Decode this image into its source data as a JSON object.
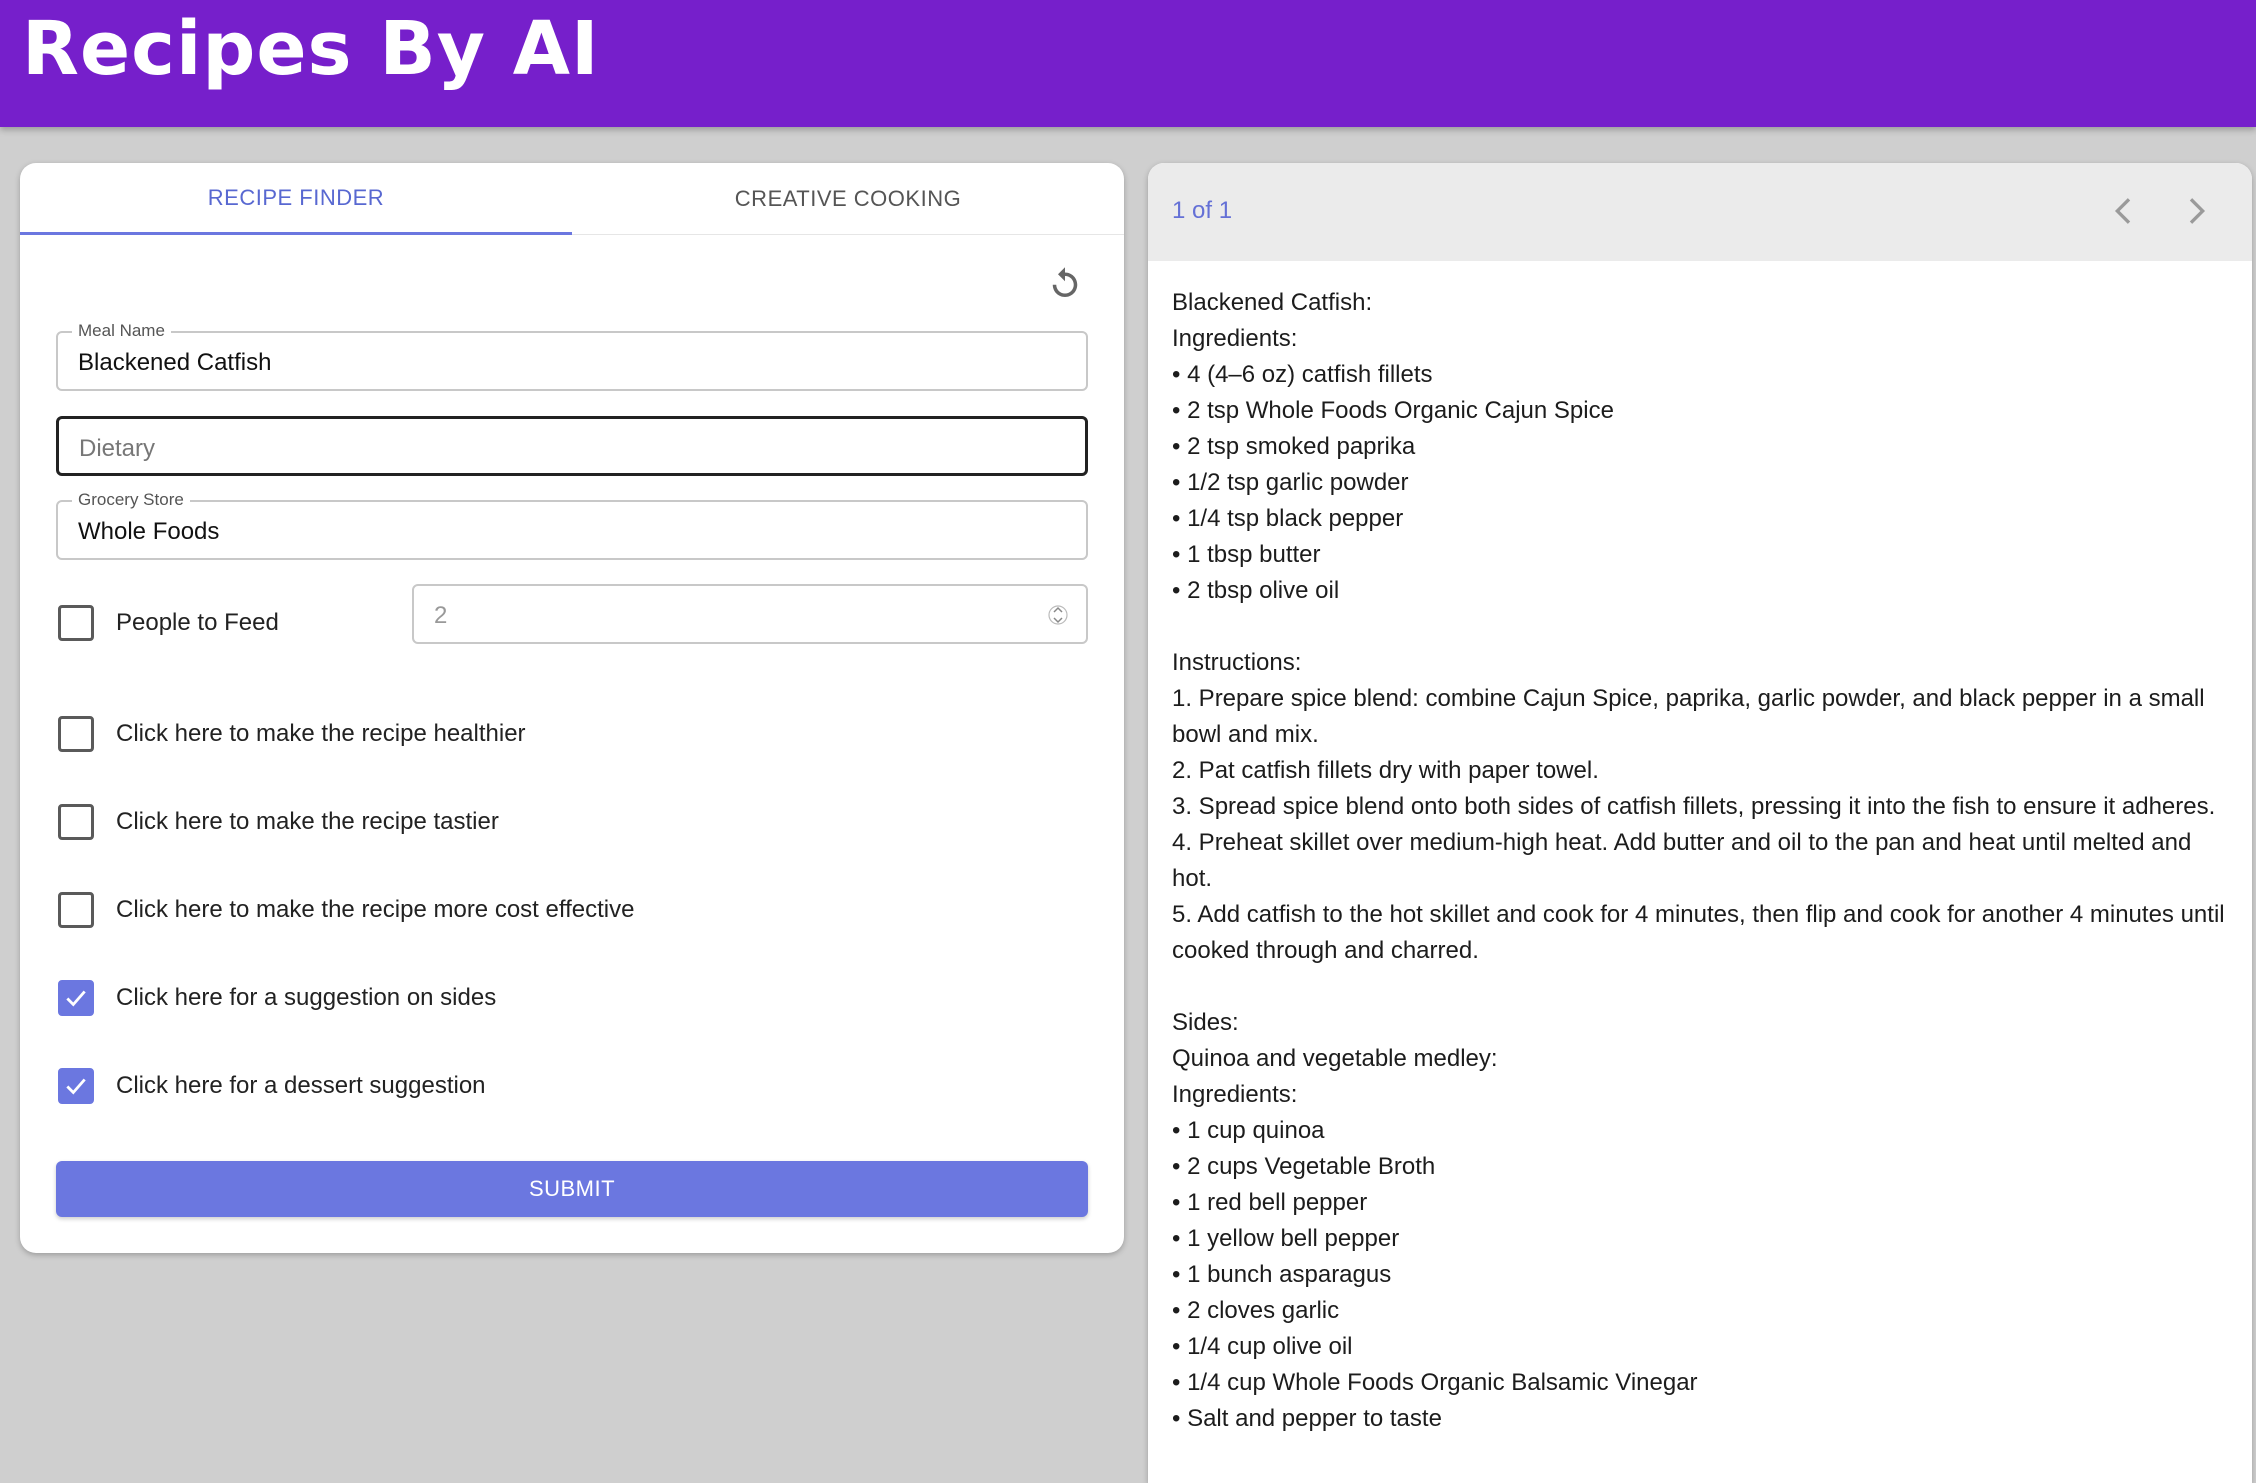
{
  "app": {
    "title": "Recipes By AI"
  },
  "tabs": [
    {
      "label": "RECIPE FINDER"
    },
    {
      "label": "CREATIVE COOKING"
    }
  ],
  "form": {
    "meal_name": {
      "label": "Meal Name",
      "value": "Blackened Catfish"
    },
    "dietary": {
      "placeholder": "Dietary"
    },
    "grocery_store": {
      "label": "Grocery Store",
      "value": "Whole Foods"
    },
    "people_to_feed": {
      "label": "People to Feed",
      "value": "2",
      "checked": false
    },
    "options": [
      {
        "label": "Click here to make the recipe healthier",
        "checked": false
      },
      {
        "label": "Click here to make the recipe tastier",
        "checked": false
      },
      {
        "label": "Click here to make the recipe more cost effective",
        "checked": false
      },
      {
        "label": "Click here for a suggestion on sides",
        "checked": true
      },
      {
        "label": "Click here for a dessert suggestion",
        "checked": true
      }
    ],
    "submit_label": "SUBMIT"
  },
  "result": {
    "pager": "1 of 1",
    "lines": [
      "Blackened Catfish:",
      "Ingredients:",
      "• 4 (4–6 oz) catfish fillets",
      "• 2 tsp Whole Foods Organic Cajun Spice",
      "• 2 tsp smoked paprika",
      "• 1/2 tsp garlic powder",
      "• 1/4 tsp black pepper",
      "• 1 tbsp butter",
      "• 2 tbsp olive oil",
      "",
      "Instructions:",
      "1. Prepare spice blend: combine Cajun Spice, paprika, garlic powder, and black pepper in a small bowl and mix.",
      "2. Pat catfish fillets dry with paper towel.",
      "3. Spread spice blend onto both sides of catfish fillets, pressing it into the fish to ensure it adheres.",
      "4. Preheat skillet over medium-high heat. Add butter and oil to the pan and heat until melted and hot.",
      "5. Add catfish to the hot skillet and cook for 4 minutes, then flip and cook for another 4 minutes until cooked through and charred.",
      "",
      "Sides:",
      "Quinoa and vegetable medley:",
      "Ingredients:",
      "• 1 cup quinoa",
      "• 2 cups Vegetable Broth",
      "• 1 red bell pepper",
      "• 1 yellow bell pepper",
      "• 1 bunch asparagus",
      "• 2 cloves garlic",
      "• 1/4 cup olive oil",
      "• 1/4 cup Whole Foods Organic Balsamic Vinegar",
      "• Salt and pepper to taste"
    ]
  },
  "colors": {
    "header": "#761fcb",
    "accent": "#6b77e0",
    "background": "#cfcfcf"
  },
  "icons": {
    "reset": "refresh-icon",
    "prev": "chevron-left-icon",
    "next": "chevron-right-icon",
    "check": "check-icon"
  }
}
